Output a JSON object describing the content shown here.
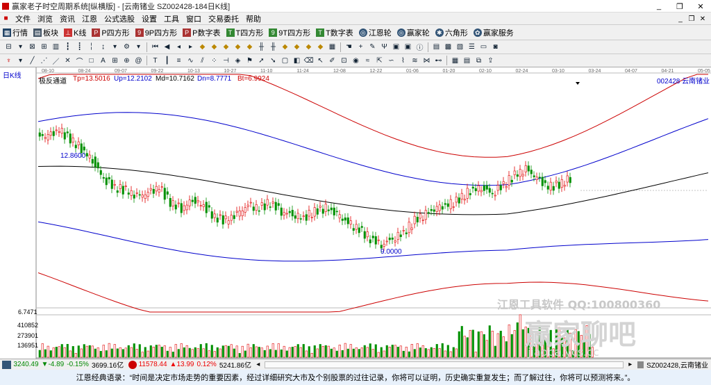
{
  "window": {
    "title": "赢家老子时空周期系统[纵横版] - [云南锗业  SZ002428-184日K线]",
    "buttons": [
      "_",
      "❐",
      "✕"
    ]
  },
  "menu": {
    "items": [
      "文件",
      "浏览",
      "资讯",
      "江恩",
      "公式选股",
      "设置",
      "工具",
      "窗口",
      "交易委托",
      "帮助"
    ]
  },
  "toolbar1": {
    "items": [
      "行情",
      "板块",
      "K线",
      "P四方形",
      "9P四方形",
      "P数字表",
      "T四方形",
      "9T四方形",
      "T数字表",
      "江恩轮",
      "赢家轮",
      "六角形",
      "赢家服务"
    ]
  },
  "chart": {
    "period_label": "日K线",
    "indicator_name": "极反通道",
    "tp_label": "Tp=13.5016",
    "up_label": "Up=12.2102",
    "md_label": "Md=10.7162",
    "dn_label": "Dn=8.7771",
    "bt_label": "Bt=6.9924",
    "stock_label": "002428  云南锗业",
    "high_label": "12.8600",
    "low_label": "9.0000",
    "date_axis": [
      "08-10",
      "08-24",
      "09-07",
      "09-22",
      "10-13",
      "10-27",
      "11-10",
      "11-24",
      "12-08",
      "12-22",
      "01-06",
      "01-20",
      "02-10",
      "02-24",
      "03-10",
      "03-24",
      "04-07",
      "04-21",
      "05-05"
    ],
    "volume_axis": [
      "6.7471",
      "410852",
      "273901",
      "136951"
    ],
    "watermark1": "江恩工具软件  QQ:100800360",
    "watermark2": "赢家聊吧",
    "watermark3": "jiaoba.ycs.cc"
  },
  "chart_data": {
    "type": "candlestick",
    "title": "",
    "close_approx": [
      12.6,
      12.8,
      12.5,
      12.2,
      11.8,
      11.2,
      10.9,
      10.8,
      10.6,
      10.7,
      10.9,
      10.4,
      10.2,
      10.5,
      10.3,
      9.9,
      9.8,
      10.0,
      10.3,
      10.2,
      10.4,
      10.1,
      10.0,
      9.9,
      10.1,
      10.2,
      10.0,
      9.7,
      9.5,
      9.2,
      9.0,
      9.2,
      9.4,
      9.8,
      10.0,
      10.2,
      10.3,
      10.5,
      10.8,
      10.9,
      10.7,
      11.0,
      11.3,
      11.5,
      11.2,
      10.9,
      11.0,
      11.2
    ],
    "channel": {
      "top": 13.5016,
      "up": 12.2102,
      "mid": 10.7162,
      "dn": 8.7771,
      "bottom": 6.9924
    },
    "marked_high": 12.86,
    "marked_low": 9.0
  },
  "status": {
    "idx1_name": "",
    "sh_value": "3240.49",
    "sh_change": "▼-4.89",
    "sh_pct": "-0.15%",
    "sh_amount": "3699.16亿",
    "sz_value": "11578.44",
    "sz_change": "▲13.99",
    "sz_pct": "0.12%",
    "sz_amount": "5241.86亿",
    "code_label": "SZ002428,云南锗业"
  },
  "quote": {
    "text": "江恩经典语录：“时间是决定市场走势的重要因素，经过详细研究大市及个别股票的过往记录，你将可以证明，历史确实重复发生；而了解过往，你将可以预测将来。”。"
  },
  "colors": {
    "up": "#e00000",
    "down": "#009000",
    "top_line": "#cc0000",
    "blue_line": "#0000cc",
    "mid_line": "#000000"
  }
}
